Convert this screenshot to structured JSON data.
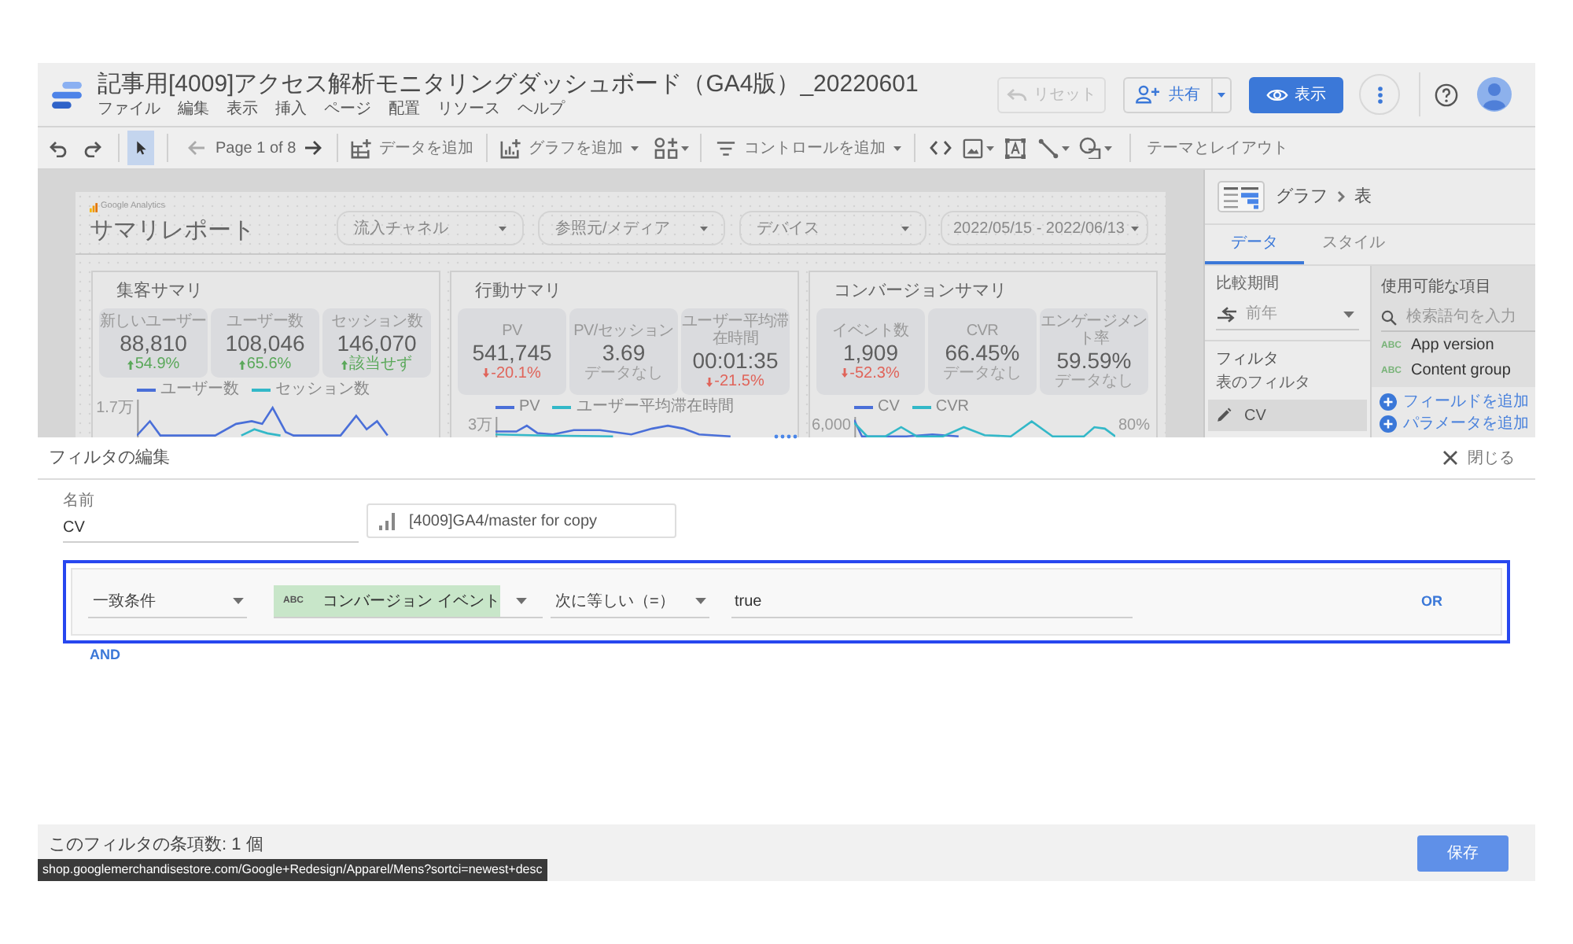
{
  "header": {
    "title": "記事用[4009]アクセス解析モニタリングダッシュボード（GA4版）_20220601",
    "menus": [
      "ファイル",
      "編集",
      "表示",
      "挿入",
      "ページ",
      "配置",
      "リソース",
      "ヘルプ"
    ],
    "reset": {
      "label": "リセット",
      "disabled": true
    },
    "share": {
      "label": "共有"
    },
    "view": {
      "label": "表示"
    }
  },
  "toolbar": {
    "pointer_selected": true,
    "page": "Page 1 of 8",
    "add_data": "データを追加",
    "add_chart": "グラフを追加",
    "add_control": "コントロールを追加",
    "theme": "テーマとレイアウト"
  },
  "report": {
    "brand": "Google Analytics",
    "title": "サマリレポート",
    "filters": [
      "流入チャネル",
      "参照元/メディア",
      "デバイス",
      "2022/05/15 - 2022/06/13"
    ],
    "cards": [
      {
        "title": "集客サマリ",
        "scorecards": [
          {
            "label": "新しいユーザー",
            "value": "88,810",
            "delta": "54.9%",
            "kind": "up"
          },
          {
            "label": "ユーザー数",
            "value": "108,046",
            "delta": "65.6%",
            "kind": "up"
          },
          {
            "label": "セッション数",
            "value": "146,070",
            "delta": "該当せず",
            "kind": "up"
          }
        ],
        "legend": [
          {
            "name": "ユーザー数",
            "color": "#4a6fd8"
          },
          {
            "name": "セッション数",
            "color": "#33b8c8"
          }
        ],
        "ticks": [
          {
            "text": "1.7万",
            "kind": "left"
          }
        ]
      },
      {
        "title": "行動サマリ",
        "scorecards": [
          {
            "label": "PV",
            "value": "541,745",
            "delta": "-20.1%",
            "kind": "down"
          },
          {
            "label": "PV/セッション",
            "value": "3.69",
            "delta": "データなし",
            "kind": "none"
          },
          {
            "label": "ユーザー平均滞在時間",
            "value": "00:01:35",
            "delta": "-21.5%",
            "kind": "down"
          }
        ],
        "legend": [
          {
            "name": "PV",
            "color": "#4a6fd8"
          },
          {
            "name": "ユーザー平均滞在時間",
            "color": "#33b8c8"
          }
        ],
        "ticks": [
          {
            "text": "3万",
            "kind": "left"
          }
        ]
      },
      {
        "title": "コンバージョンサマリ",
        "scorecards": [
          {
            "label": "イベント数",
            "value": "1,909",
            "delta": "-52.3%",
            "kind": "down"
          },
          {
            "label": "CVR",
            "value": "66.45%",
            "delta": "データなし",
            "kind": "none"
          },
          {
            "label": "エンゲージメント率",
            "value": "59.59%",
            "delta": "データなし",
            "kind": "none"
          }
        ],
        "legend": [
          {
            "name": "CV",
            "color": "#4a6fd8"
          },
          {
            "name": "CVR",
            "color": "#33b8c8"
          }
        ],
        "ticks": [
          {
            "text": "6,000",
            "kind": "left"
          },
          {
            "text": "80%",
            "kind": "right"
          }
        ]
      }
    ]
  },
  "panel": {
    "breadcrumb": [
      "グラフ",
      "表"
    ],
    "tabs": [
      {
        "label": "データ",
        "selected": true
      },
      {
        "label": "スタイル",
        "selected": false
      }
    ],
    "comparison": {
      "label": "比較期間",
      "value": "前年"
    },
    "filter": {
      "heading": "フィルタ",
      "label": "表のフィルタ",
      "chip": "CV"
    },
    "fields": {
      "heading": "使用可能な項目",
      "search_placeholder": "検索語句を入力",
      "items": [
        {
          "type": "ABC",
          "name": "App version"
        },
        {
          "type": "ABC",
          "name": "Content group"
        }
      ],
      "actions": [
        "フィールドを追加",
        "パラメータを追加"
      ]
    }
  },
  "filter_editor": {
    "title": "フィルタの編集",
    "close": "閉じる",
    "name": {
      "label": "名前",
      "value": "CV"
    },
    "data_source": "[4009]GA4/master for copy",
    "clauses": [
      {
        "match": "一致条件",
        "field_type": "ABC",
        "field": "コンバージョン イベント",
        "operator": "次に等しい（=）",
        "value": "true",
        "or": "OR"
      }
    ],
    "and": "AND",
    "footer": "このフィルタの条項数: 1 個",
    "save": "保存"
  },
  "link_preview": "shop.googlemerchandisestore.com/Google+Redesign/Apparel/Mens?sortci=newest+desc"
}
